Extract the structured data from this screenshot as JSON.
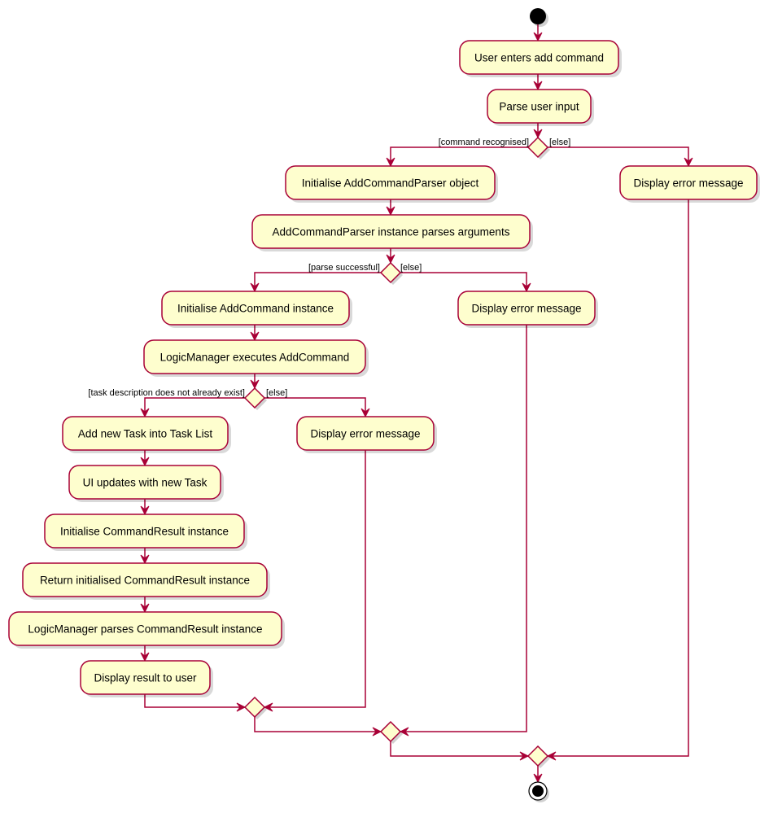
{
  "colors": {
    "border": "#A80036",
    "fill": "#FEFECE",
    "terminal": "#000000"
  },
  "activities": [
    "User enters add command",
    "Parse user input",
    "Initialise AddCommandParser object",
    "Display error message",
    "AddCommandParser instance parses arguments",
    "Initialise AddCommand instance",
    "Display error message",
    "LogicManager executes AddCommand",
    "Add new Task into Task List",
    "Display error message",
    "UI updates with new Task",
    "Initialise CommandResult instance",
    "Return initialised CommandResult instance",
    "LogicManager parses CommandResult instance",
    "Display result to user"
  ],
  "guards": [
    "[command recognised]",
    "[else]",
    "[parse successful]",
    "[else]",
    "[task description does not already exist]",
    "[else]"
  ]
}
